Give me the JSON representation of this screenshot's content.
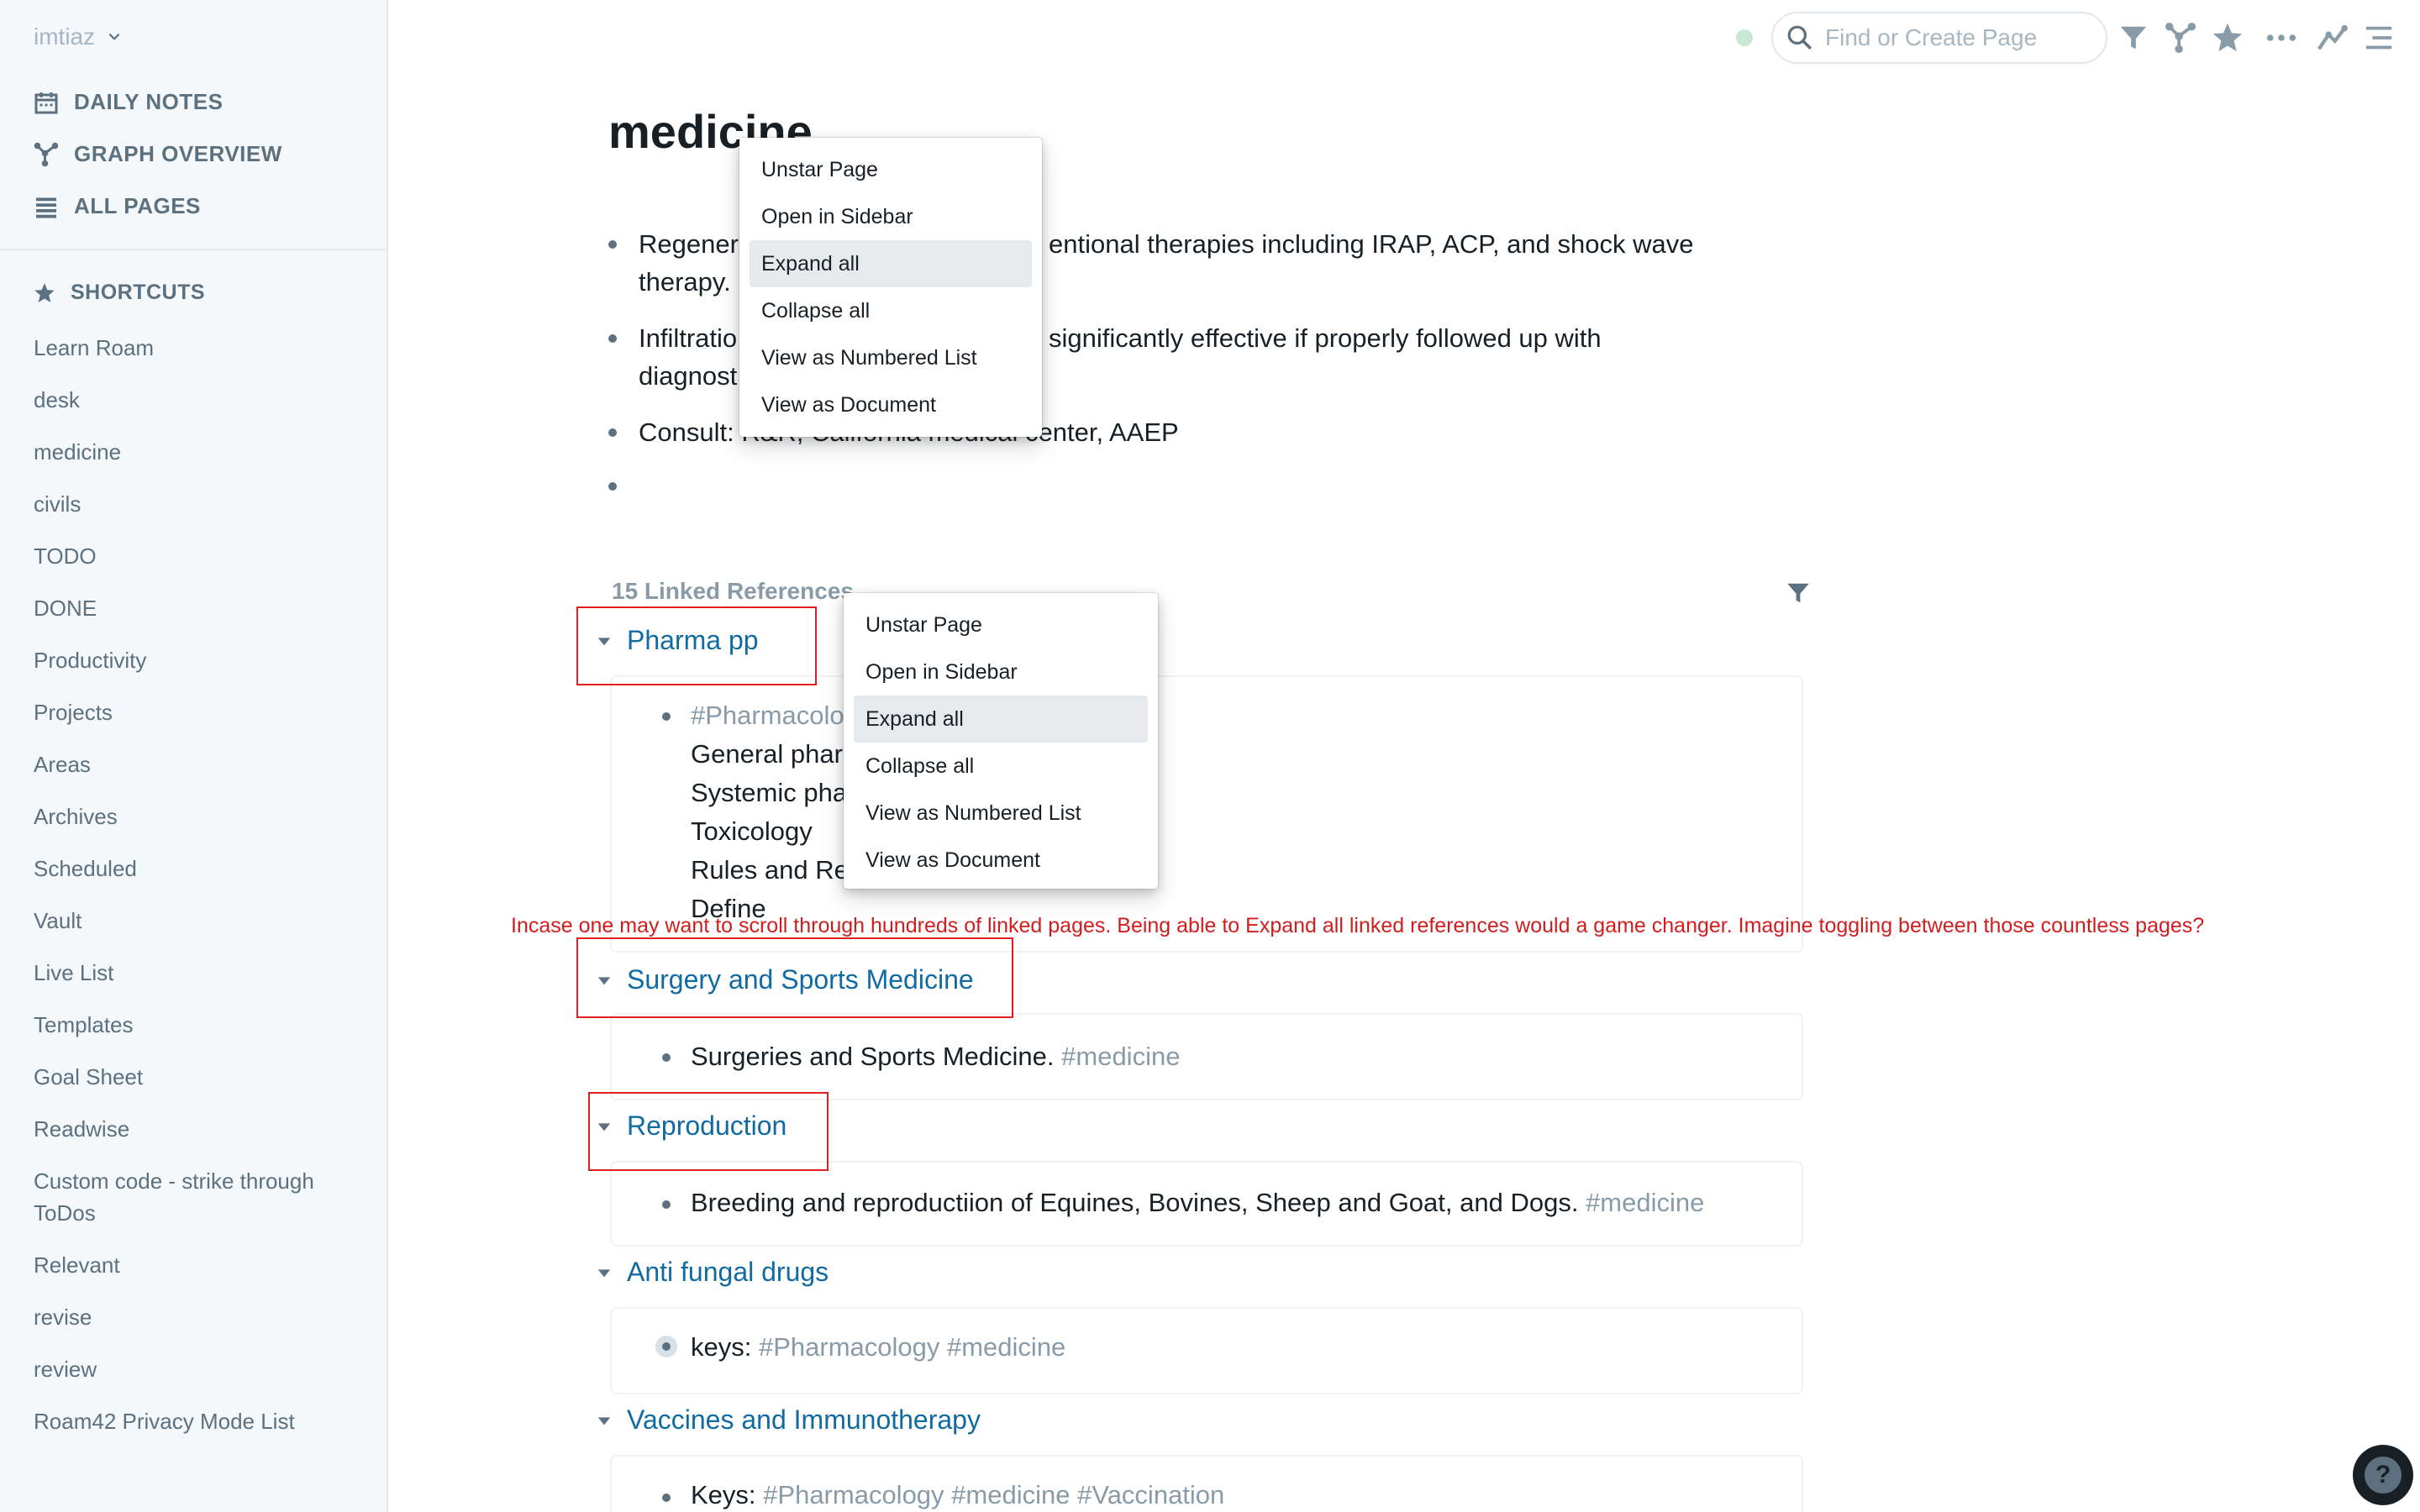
{
  "sidebar": {
    "workspace": "imtiaz",
    "nav": [
      {
        "label": "DAILY NOTES",
        "icon": "calendar-icon"
      },
      {
        "label": "GRAPH OVERVIEW",
        "icon": "graph-icon"
      },
      {
        "label": "ALL PAGES",
        "icon": "list-icon"
      }
    ],
    "shortcuts_title": "SHORTCUTS",
    "shortcuts": [
      "Learn Roam",
      "desk",
      "medicine",
      "civils",
      "TODO",
      "DONE",
      "Productivity",
      "Projects",
      "Areas",
      "Archives",
      "Scheduled",
      "Vault",
      "Live List",
      "Templates",
      "Goal Sheet",
      "Readwise",
      "Custom code - strike through ToDos",
      "Relevant",
      "revise",
      "review",
      "Roam42 Privacy Mode List"
    ]
  },
  "topbar": {
    "search_placeholder": "Find or Create Page"
  },
  "page": {
    "title": "medicine",
    "blocks": [
      {
        "line1": "Regener",
        "line1b": "entional therapies including IRAP, ACP, and shock wave",
        "line2": "therapy."
      },
      {
        "line1": "Infiltratio",
        "line1b": "significantly effective if properly followed up with",
        "line2": "diagnost"
      },
      {
        "line1": "Consult: R&R, California medical center, AAEP"
      }
    ]
  },
  "linked_refs": {
    "title": "15 Linked References",
    "groups": [
      {
        "name": "Pharma pp",
        "lines": [
          "#Pharmacolo",
          "General phar",
          "Systemic pha",
          "Toxicology",
          "Rules and Regulations",
          "Define"
        ]
      },
      {
        "name": "Surgery and Sports Medicine",
        "text": "Surgeries and Sports Medicine.",
        "tags": "#medicine"
      },
      {
        "name": "Reproduction",
        "text": "Breeding and reproductiion of Equines, Bovines, Sheep and Goat, and Dogs.",
        "tags": "#medicine"
      },
      {
        "name": "Anti fungal drugs",
        "text": "keys:",
        "tags": "#Pharmacology #medicine"
      },
      {
        "name": "Vaccines and Immunotherapy",
        "text": "Keys:",
        "tags": "#Pharmacology #medicine #Vaccination"
      }
    ]
  },
  "annotation": "Incase one may want to scroll through hundreds of linked pages. Being able to Expand all linked references would a game changer. Imagine toggling between those countless pages?",
  "menu_top": [
    "Unstar Page",
    "Open in Sidebar",
    "Expand all",
    "Collapse all",
    "View as Numbered List",
    "View as Document"
  ],
  "menu_ref": [
    "Unstar Page",
    "Open in Sidebar",
    "Expand all",
    "Collapse all",
    "View as Numbered List",
    "View as Document"
  ],
  "help_label": "?",
  "colors": {
    "link": "#106ba3",
    "annotation": "#d01e1e",
    "sidebar_bg": "#f5f8fa"
  }
}
